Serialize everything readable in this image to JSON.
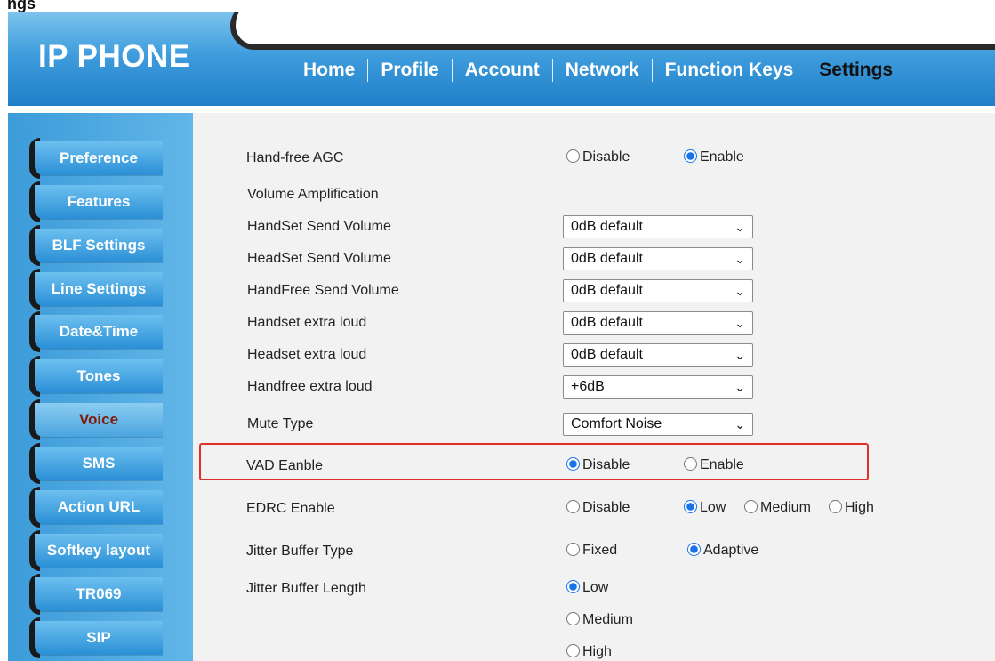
{
  "top_fragment": "ngs",
  "header": {
    "logo": "IP PHONE",
    "nav": [
      {
        "label": "Home"
      },
      {
        "label": "Profile"
      },
      {
        "label": "Account"
      },
      {
        "label": "Network"
      },
      {
        "label": "Function Keys"
      },
      {
        "label": "Settings"
      }
    ]
  },
  "sidebar": {
    "items": [
      {
        "label": "Preference"
      },
      {
        "label": "Features"
      },
      {
        "label": "BLF Settings"
      },
      {
        "label": "Line Settings"
      },
      {
        "label": "Date&Time"
      },
      {
        "label": "Tones"
      },
      {
        "label": "Voice"
      },
      {
        "label": "SMS"
      },
      {
        "label": "Action URL"
      },
      {
        "label": "Softkey layout"
      },
      {
        "label": "TR069"
      },
      {
        "label": "SIP"
      }
    ]
  },
  "voice": {
    "handfree_agc": {
      "label": "Hand-free AGC",
      "opt1": "Disable",
      "opt2": "Enable",
      "selected": "Enable"
    },
    "volume_amplification_label": "Volume Amplification",
    "handset_send_volume": {
      "label": "HandSet Send Volume",
      "value": "0dB default"
    },
    "headset_send_volume": {
      "label": "HeadSet Send Volume",
      "value": "0dB default"
    },
    "handfree_send_volume": {
      "label": "HandFree Send Volume",
      "value": "0dB default"
    },
    "handset_extra_loud": {
      "label": "Handset extra loud",
      "value": "0dB default"
    },
    "headset_extra_loud": {
      "label": "Headset extra loud",
      "value": "0dB default"
    },
    "handfree_extra_loud": {
      "label": "Handfree extra loud",
      "value": "+6dB"
    },
    "mute_type": {
      "label": "Mute Type",
      "value": "Comfort Noise"
    },
    "vad_enable": {
      "label": "VAD Eanble",
      "opt1": "Disable",
      "opt2": "Enable",
      "selected": "Disable"
    },
    "edrc_enable": {
      "label": "EDRC Enable",
      "opt1": "Disable",
      "opt2": "Low",
      "opt3": "Medium",
      "opt4": "High",
      "selected": "Low"
    },
    "jitter_buffer_type": {
      "label": "Jitter Buffer Type",
      "opt1": "Fixed",
      "opt2": "Adaptive",
      "selected": "Adaptive"
    },
    "jitter_buffer_length": {
      "label": "Jitter Buffer Length",
      "opt1": "Low",
      "opt2": "Medium",
      "opt3": "High",
      "selected": "Low"
    }
  },
  "colors": {
    "header_blue": "#2a8fd6",
    "highlight_red": "#e0302a",
    "radio_selected": "#1a73e8"
  }
}
